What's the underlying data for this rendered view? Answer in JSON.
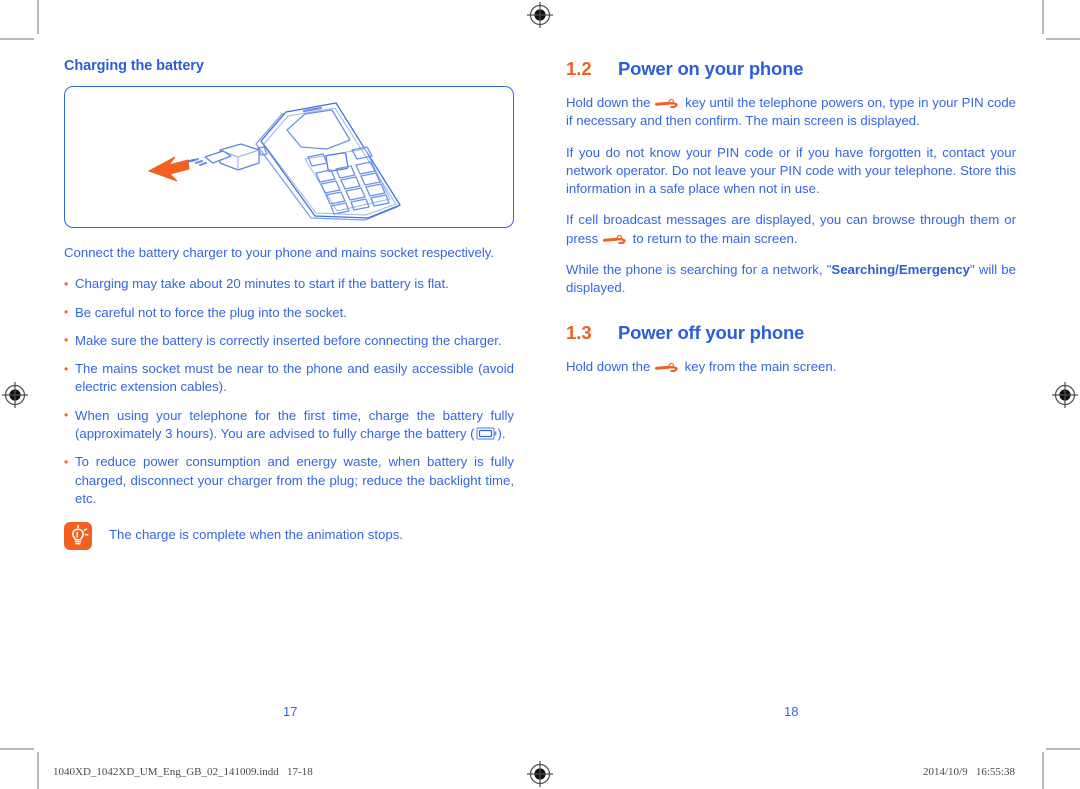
{
  "document": {
    "left_page": {
      "subheading": "Charging the battery",
      "figure_caption_alt": "phone-charging-illustration",
      "intro": "Connect the battery charger to your phone and mains socket respectively.",
      "bullets": [
        "Charging may take about 20 minutes to start if the battery is flat.",
        "Be careful not to force the plug into the socket.",
        "Make sure the battery is correctly inserted before connecting the charger.",
        "The mains socket must be near to the phone and easily accessible (avoid electric extension cables).",
        "When using your telephone for the first time, charge the battery fully (approximately 3 hours). You are advised to fully charge the battery",
        "To reduce power consumption and energy waste, when battery is fully charged, disconnect your charger from the plug; reduce the backlight time, etc."
      ],
      "bullet5_suffix": ").",
      "bullet5_prefix_paren": "(",
      "tip_text": "The charge is complete when the animation stops.",
      "page_number": "17"
    },
    "right_page": {
      "sections": [
        {
          "number": "1.2",
          "title": "Power on your phone",
          "paragraphs": [
            {
              "before": "Hold down the",
              "glyph": "power-key-icon",
              "after": "key until the telephone powers on, type in your PIN code if necessary and then confirm. The main screen is displayed."
            },
            {
              "text": "If you do not know your PIN code or if you have forgotten it, contact your network operator. Do not leave your PIN code with your telephone. Store this information in a safe place when not in use."
            },
            {
              "before": "If cell broadcast messages are displayed, you can browse through them or press",
              "glyph": "power-key-icon",
              "after": "to return to the main screen."
            },
            {
              "before": "While the phone is searching for a network,",
              "quote_open": "\"",
              "bold": "Searching/Emergency",
              "quote_close": "\"",
              "after": "will be displayed."
            }
          ]
        },
        {
          "number": "1.3",
          "title": "Power off your phone",
          "paragraphs": [
            {
              "before": "Hold down the",
              "glyph": "power-key-icon",
              "after": "key from the main screen."
            }
          ]
        }
      ],
      "page_number": "18"
    },
    "footer": {
      "filename": "1040XD_1042XD_UM_Eng_GB_02_141009.indd   17-18",
      "timestamp": "2014/10/9   16:55:38"
    },
    "colors": {
      "body_blue": "#3366e0",
      "heading_blue": "#2b5fd9",
      "accent_orange": "#f26122",
      "crop_gray": "#b9b9b9"
    }
  }
}
